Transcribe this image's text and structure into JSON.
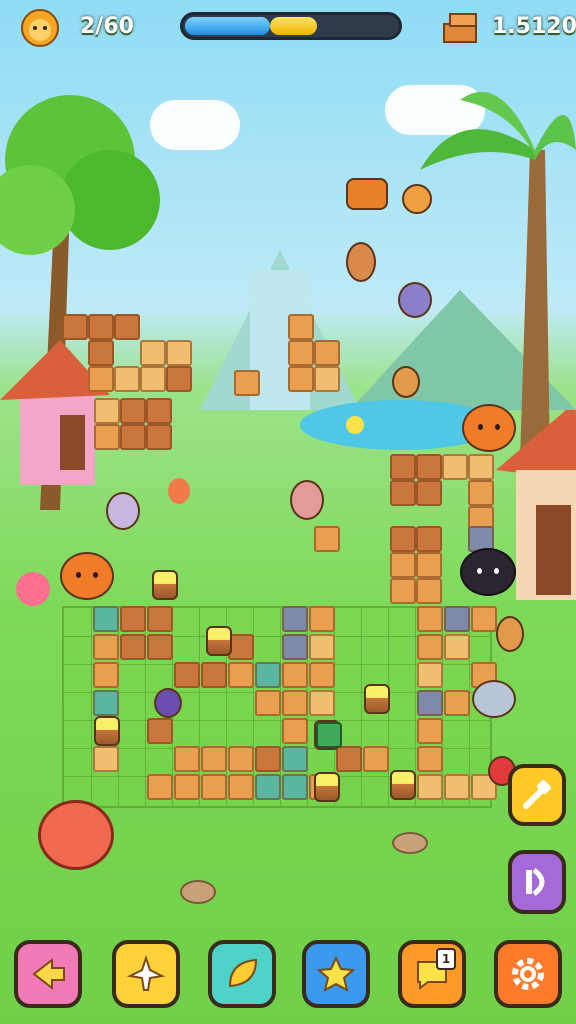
{
  "hud": {
    "lives": "2/60",
    "coins": "1.5120",
    "progress_blue": 0.4,
    "progress_yellow": 0.22
  },
  "colors": {
    "sky": "#8fdcf5",
    "grass": "#7ed957",
    "tile_orange": "#e8a050",
    "tile_brown": "#c8763c",
    "progress_blue": "#1e8fe0",
    "progress_yellow": "#f0b400"
  },
  "icons": {
    "lives": "lion-face-icon",
    "coins": "brick-stack-icon",
    "side_buttons": [
      "hammer-icon",
      "exit-door-icon"
    ],
    "bottom_buttons": [
      "back-arrow-icon",
      "airplane-icon",
      "leaf-icon",
      "star-icon",
      "message-icon",
      "settings-gear-icon"
    ]
  },
  "bottom_bar": {
    "message_badge": "1"
  }
}
